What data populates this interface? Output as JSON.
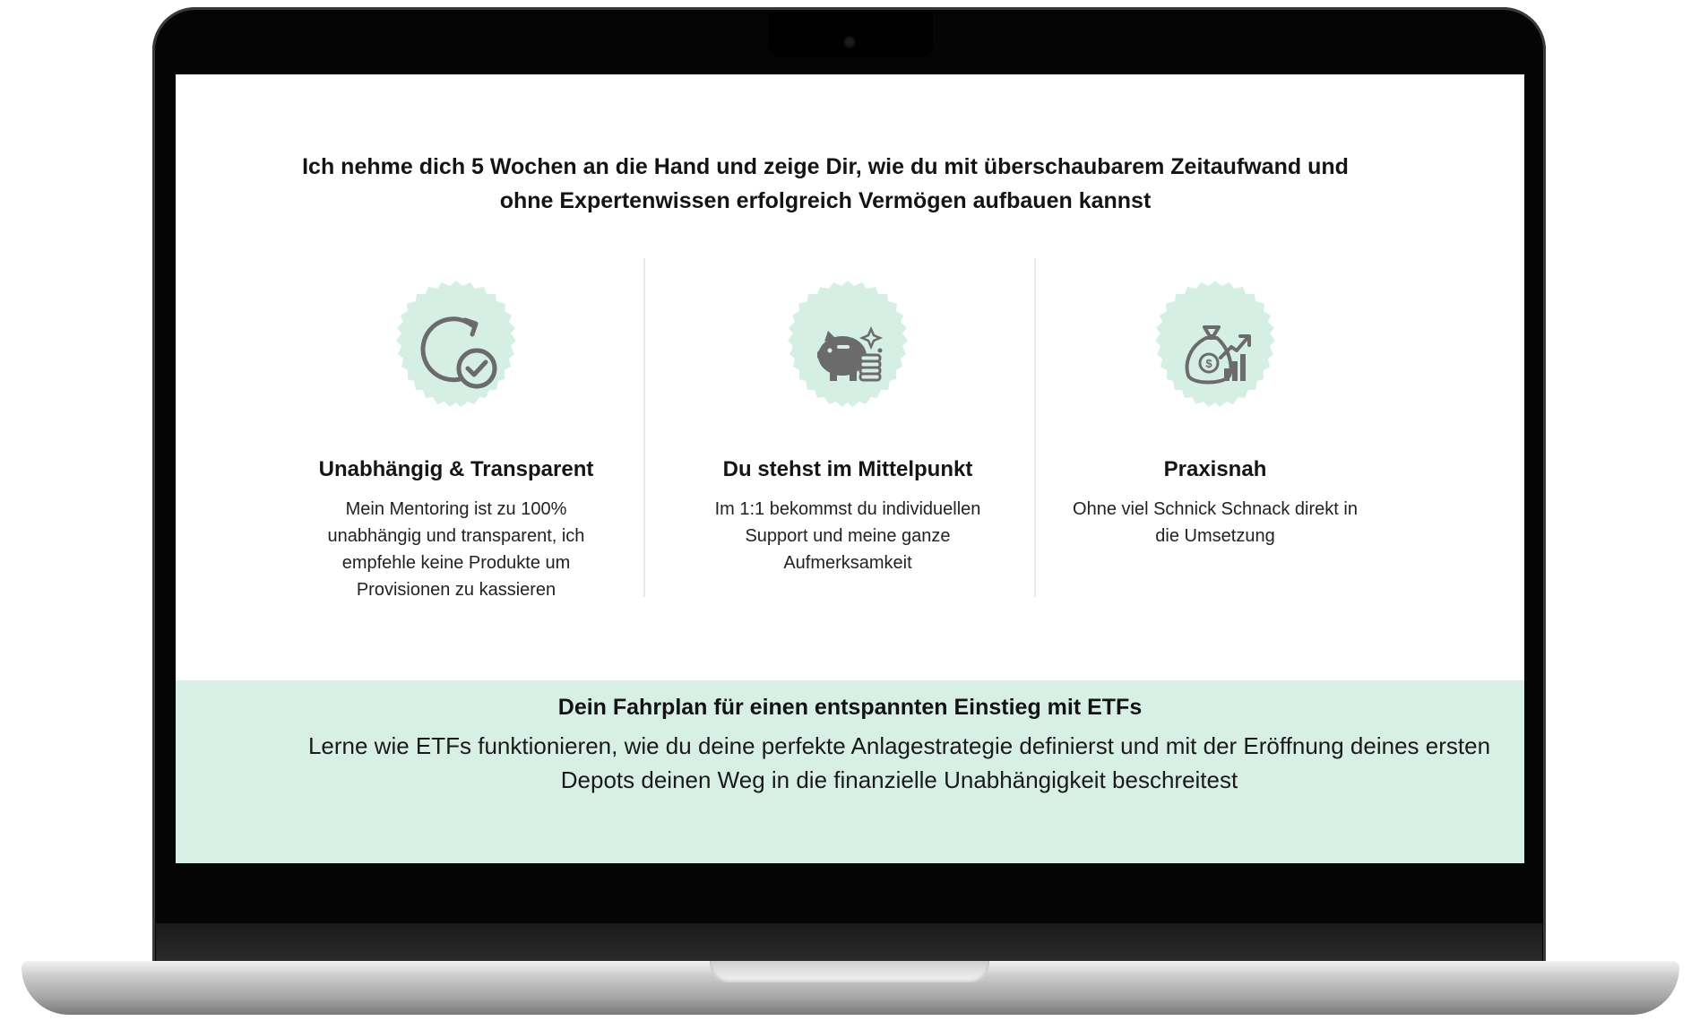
{
  "headline": "Ich nehme dich 5 Wochen an die Hand und zeige Dir, wie du mit überschaubarem Zeitaufwand und ohne Expertenwissen erfolgreich Vermögen aufbauen kannst",
  "features": [
    {
      "icon": "refresh-check-icon",
      "title": "Unabhängig & Transparent",
      "description": "Mein Mentoring ist zu 100% unabhängig und transparent, ich empfehle keine Produkte um Provisionen zu kassieren"
    },
    {
      "icon": "piggy-bank-icon",
      "title": "Du stehst im Mittelpunkt",
      "description": "Im 1:1 bekommst du individuellen Support und meine ganze Aufmerksamkeit"
    },
    {
      "icon": "money-bag-chart-icon",
      "title": "Praxisnah",
      "description": "Ohne viel Schnick Schnack direkt in die Umsetzung"
    }
  ],
  "band": {
    "title": "Dein Fahrplan für einen entspannten Einstieg mit ETFs",
    "text": "Lerne wie ETFs funktionieren, wie du deine perfekte Anlagestrategie definierst und mit der Eröffnung deines ersten Depots deinen Weg in die finanzielle Unabhängigkeit beschreitest"
  },
  "colors": {
    "accent_band": "#d8efe6",
    "badge": "#d6efe5",
    "icon": "#6b6b6b"
  }
}
